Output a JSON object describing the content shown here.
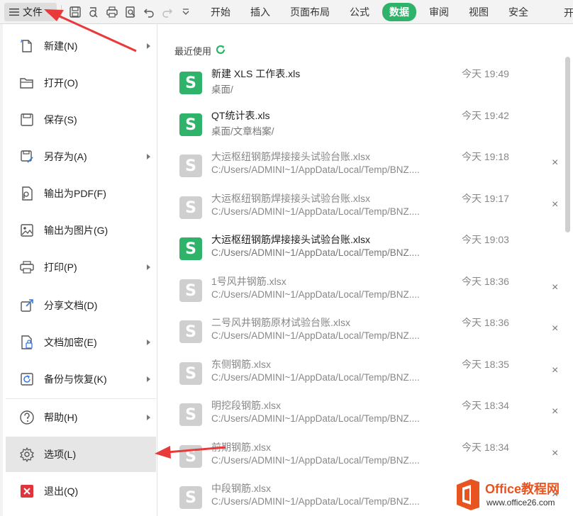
{
  "toolbar": {
    "file_label": "文件",
    "tabs": [
      {
        "label": "开始",
        "active": false
      },
      {
        "label": "插入",
        "active": false
      },
      {
        "label": "页面布局",
        "active": false
      },
      {
        "label": "公式",
        "active": false
      },
      {
        "label": "数据",
        "active": true
      },
      {
        "label": "审阅",
        "active": false
      },
      {
        "label": "视图",
        "active": false
      },
      {
        "label": "安全",
        "active": false
      }
    ],
    "edge_text": "开"
  },
  "file_menu": {
    "items": [
      {
        "label": "新建(N)",
        "icon": "new-file-icon",
        "submenu": true
      },
      {
        "label": "打开(O)",
        "icon": "folder-icon",
        "submenu": false
      },
      {
        "label": "保存(S)",
        "icon": "save-icon",
        "submenu": false
      },
      {
        "label": "另存为(A)",
        "icon": "save-as-icon",
        "submenu": true
      },
      {
        "label": "输出为PDF(F)",
        "icon": "pdf-icon",
        "submenu": false
      },
      {
        "label": "输出为图片(G)",
        "icon": "image-icon",
        "submenu": false
      },
      {
        "label": "打印(P)",
        "icon": "printer-icon",
        "submenu": true
      },
      {
        "label": "分享文档(D)",
        "icon": "share-icon",
        "submenu": false
      },
      {
        "label": "文档加密(E)",
        "icon": "encrypt-icon",
        "submenu": true
      },
      {
        "label": "备份与恢复(K)",
        "icon": "backup-icon",
        "submenu": true
      },
      {
        "label": "帮助(H)",
        "icon": "help-icon",
        "submenu": true
      },
      {
        "label": "选项(L)",
        "icon": "gear-icon",
        "submenu": false,
        "selected": true
      },
      {
        "label": "退出(Q)",
        "icon": "exit-icon",
        "submenu": false
      }
    ]
  },
  "recent": {
    "title": "最近使用",
    "files": [
      {
        "name": "新建 XLS 工作表.xls",
        "path": "桌面/",
        "time": "今天 19:49",
        "available": true,
        "close": ""
      },
      {
        "name": "QT统计表.xls",
        "path": "桌面/文章档案/",
        "time": "今天 19:42",
        "available": true,
        "close": ""
      },
      {
        "name": "大运枢纽钢筋焊接接头试验台账.xlsx",
        "path": "C:/Users/ADMINI~1/AppData/Local/Temp/BNZ....",
        "time": "今天 19:18",
        "available": false,
        "close": "×"
      },
      {
        "name": "大运枢纽钢筋焊接接头试验台账.xlsx",
        "path": "C:/Users/ADMINI~1/AppData/Local/Temp/BNZ....",
        "time": "今天 19:17",
        "available": false,
        "close": "×"
      },
      {
        "name": "大运枢纽钢筋焊接接头试验台账.xlsx",
        "path": "C:/Users/ADMINI~1/AppData/Local/Temp/BNZ....",
        "time": "今天 19:03",
        "available": true,
        "close": ""
      },
      {
        "name": "1号风井钢筋.xlsx",
        "path": "C:/Users/ADMINI~1/AppData/Local/Temp/BNZ....",
        "time": "今天 18:36",
        "available": false,
        "close": "×"
      },
      {
        "name": "二号风井钢筋原材试验台账.xlsx",
        "path": "C:/Users/ADMINI~1/AppData/Local/Temp/BNZ....",
        "time": "今天 18:36",
        "available": false,
        "close": "×"
      },
      {
        "name": "东侧钢筋.xlsx",
        "path": "C:/Users/ADMINI~1/AppData/Local/Temp/BNZ....",
        "time": "今天 18:35",
        "available": false,
        "close": "×"
      },
      {
        "name": "明挖段钢筋.xlsx",
        "path": "C:/Users/ADMINI~1/AppData/Local/Temp/BNZ....",
        "time": "今天 18:34",
        "available": false,
        "close": "×"
      },
      {
        "name": "前期钢筋.xlsx",
        "path": "C:/Users/ADMINI~1/AppData/Local/Temp/BNZ....",
        "time": "今天 18:34",
        "available": false,
        "close": "×"
      },
      {
        "name": "中段钢筋.xlsx",
        "path": "C:/Users/ADMINI~1/AppData/Local/Temp/BNZ....",
        "time": "",
        "available": false,
        "close": "×"
      }
    ],
    "file_icon_letter": "S"
  },
  "watermark": {
    "title": "Office教程网",
    "url": "www.office26.com"
  },
  "colors": {
    "accent_green": "#2fb36a",
    "annotation_red": "#e8393b",
    "watermark_orange": "#e8541f"
  }
}
